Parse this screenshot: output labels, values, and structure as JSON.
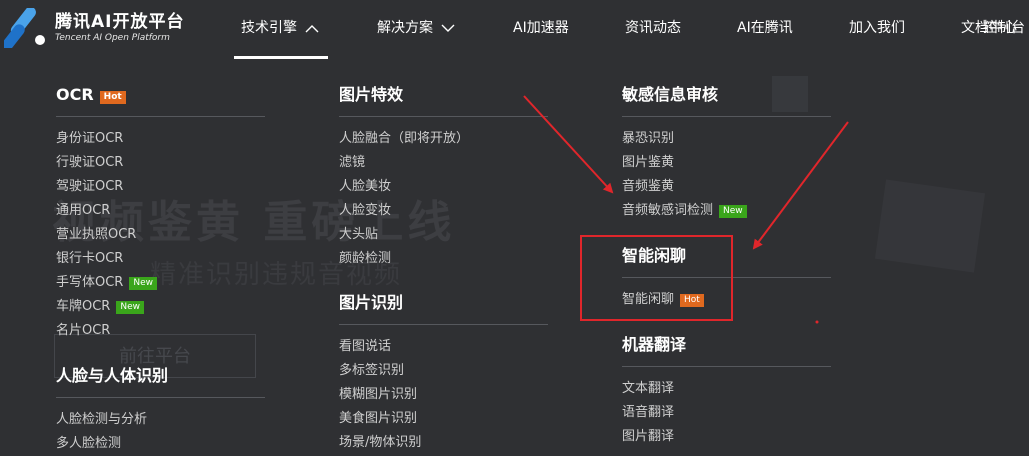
{
  "brand": {
    "name": "腾讯AI开放平台",
    "tagline": "Tencent AI Open Platform"
  },
  "nav": {
    "items": [
      "技术引擎",
      "解决方案",
      "AI加速器",
      "资讯动态",
      "AI在腾讯",
      "加入我们",
      "文档中心"
    ],
    "console": "控制台"
  },
  "background": {
    "banner_title": "视频鉴黄 重磅上线",
    "banner_sub": "精准识别违规音视频",
    "banner_button": "前往平台"
  },
  "menu": {
    "col1": {
      "section1": {
        "title": "OCR",
        "badge": "Hot",
        "items": [
          {
            "label": "身份证OCR",
            "badge": ""
          },
          {
            "label": "行驶证OCR",
            "badge": ""
          },
          {
            "label": "驾驶证OCR",
            "badge": ""
          },
          {
            "label": "通用OCR",
            "badge": ""
          },
          {
            "label": "营业执照OCR",
            "badge": ""
          },
          {
            "label": "银行卡OCR",
            "badge": ""
          },
          {
            "label": "手写体OCR",
            "badge": "New"
          },
          {
            "label": "车牌OCR",
            "badge": "New"
          },
          {
            "label": "名片OCR",
            "badge": ""
          }
        ]
      },
      "section2": {
        "title": "人脸与人体识别",
        "items": [
          {
            "label": "人脸检测与分析"
          },
          {
            "label": "多人脸检测"
          }
        ]
      }
    },
    "col2": {
      "section1": {
        "title": "图片特效",
        "items": [
          {
            "label": "人脸融合（即将开放）"
          },
          {
            "label": "滤镜"
          },
          {
            "label": "人脸美妆"
          },
          {
            "label": "人脸变妆"
          },
          {
            "label": "大头贴"
          },
          {
            "label": "颜龄检测"
          }
        ]
      },
      "section2": {
        "title": "图片识别",
        "items": [
          {
            "label": "看图说话"
          },
          {
            "label": "多标签识别"
          },
          {
            "label": "模糊图片识别"
          },
          {
            "label": "美食图片识别"
          },
          {
            "label": "场景/物体识别"
          }
        ]
      }
    },
    "col3": {
      "section1": {
        "title": "敏感信息审核",
        "items": [
          {
            "label": "暴恐识别",
            "badge": ""
          },
          {
            "label": "图片鉴黄",
            "badge": ""
          },
          {
            "label": "音频鉴黄",
            "badge": ""
          },
          {
            "label": "音频敏感词检测",
            "badge": "New"
          }
        ]
      },
      "section2": {
        "title": "智能闲聊",
        "items": [
          {
            "label": "智能闲聊",
            "badge": "Hot"
          }
        ]
      },
      "section3": {
        "title": "机器翻译",
        "items": [
          {
            "label": "文本翻译"
          },
          {
            "label": "语音翻译"
          },
          {
            "label": "图片翻译"
          }
        ]
      }
    }
  },
  "colors": {
    "background": "#2f3033",
    "hot": "#e0691f",
    "new": "#3aa51b",
    "annotation": "#e0262b"
  }
}
